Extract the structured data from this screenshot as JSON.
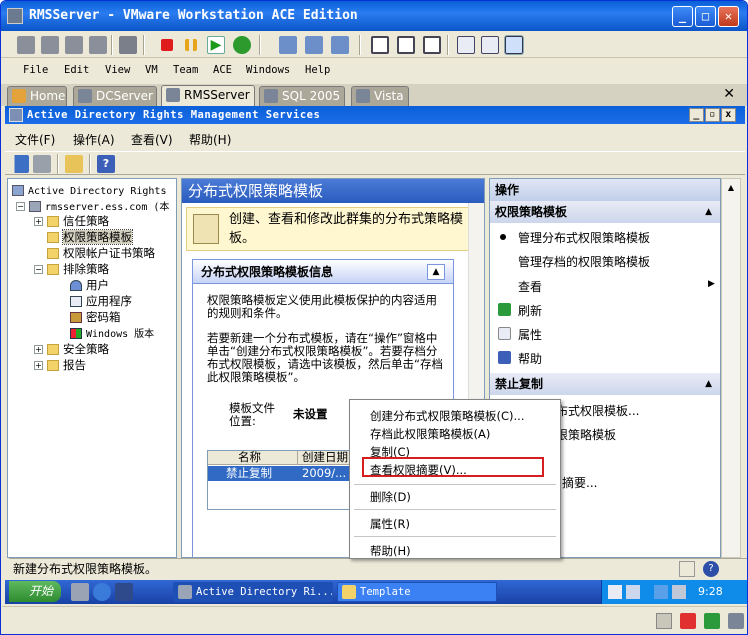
{
  "window": {
    "title": "RMSServer - VMware Workstation ACE Edition",
    "minimize": "_",
    "maximize": "□",
    "close": "✕"
  },
  "menu": [
    "File",
    "Edit",
    "View",
    "VM",
    "Team",
    "ACE",
    "Windows",
    "Help"
  ],
  "tabs": [
    {
      "label": "Home",
      "active": false
    },
    {
      "label": "DCServer",
      "active": false
    },
    {
      "label": "RMSServer",
      "active": true
    },
    {
      "label": "SQL 2005",
      "active": false
    },
    {
      "label": "Vista",
      "active": false
    }
  ],
  "tab_close": "✕",
  "mmc": {
    "title": "Active Directory Rights Management Services",
    "menu": [
      "文件(F)",
      "操作(A)",
      "查看(V)",
      "帮助(H)"
    ]
  },
  "tree": {
    "root": "Active Directory Rights",
    "server": "rmsserver.ess.com (本",
    "items": [
      "信任策略",
      "权限策略模板",
      "权限帐户证书策略",
      "排除策略",
      "用户",
      "应用程序",
      "密码箱",
      "Windows 版本",
      "安全策略",
      "报告"
    ]
  },
  "center": {
    "header": "分布式权限策略模板",
    "description": "创建、查看和修改此群集的分布式策略模板。",
    "info_title": "分布式权限策略模板信息",
    "para1": "权限策略模板定义使用此模板保护的内容适用的规则和条件。",
    "para2": "若要新建一个分布式模板，请在“操作”窗格中单击“创建分布式权限策略模板”。若要存档分布式权限模板，请选中该模板，然后单击“存档此权限策略模板”。",
    "location_label": "模板文件位置:",
    "location_value": "未设置",
    "col_name": "名称",
    "col_date": "创建日期",
    "row_name": "禁止复制",
    "row_date": "2009/..."
  },
  "actions": {
    "title": "操作",
    "section1": "权限策略模板",
    "items1": [
      "管理分布式权限策略模板",
      "管理存档的权限策略模板",
      "查看",
      "刷新",
      "属性",
      "帮助"
    ],
    "section2": "禁止复制",
    "items2": [
      "布式权限模板...",
      "限策略模板",
      "摘要..."
    ]
  },
  "context_menu": [
    "创建分布式权限策略模板(C)...",
    "存档此权限策略模板(A)",
    "复制(C)",
    "查看权限摘要(V)...",
    "删除(D)",
    "属性(R)",
    "帮助(H)"
  ],
  "status": "新建分布式权限策略模板。",
  "taskbar": {
    "start": "开始",
    "items": [
      "Active Directory Ri...",
      "Template"
    ],
    "time": "9:28"
  }
}
